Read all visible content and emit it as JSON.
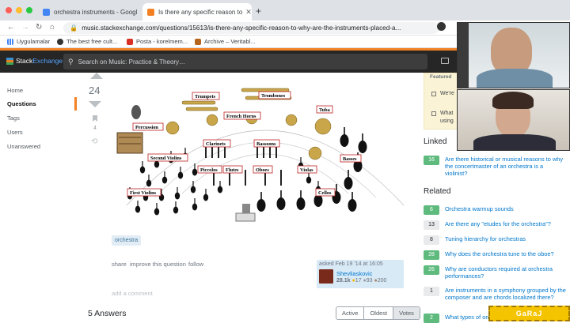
{
  "browser": {
    "tabs": [
      {
        "title": "orchestra instruments - Googl",
        "favicon_color": "#4285f4"
      },
      {
        "title": "Is there any specific reason to",
        "favicon_color": "#f48024"
      }
    ],
    "new_tab": "+",
    "url": "music.stackexchange.com/questions/15613/is-there-any-specific-reason-to-why-are-the-instruments-placed-a...",
    "bookmarks": [
      "Uygulamalar",
      "The best free cult...",
      "Posta - korelmem...",
      "Archive – Veritabl..."
    ]
  },
  "site": {
    "logo_a": "Stack",
    "logo_b": "Exchange",
    "search_placeholder": "Search on Music: Practice & Theory…"
  },
  "leftnav": [
    "Home",
    "Questions",
    "Tags",
    "Users",
    "Unanswered"
  ],
  "question": {
    "score": "24",
    "bookmarks": "4",
    "tag": "orchestra",
    "actions": [
      "share",
      "improve this question",
      "follow"
    ],
    "asked": "asked Feb 19 '14 at 16:05",
    "user": "Shevliaskovic",
    "rep": "28.1k",
    "gold": "17",
    "silver": "93",
    "bronze": "200",
    "add_comment": "add a comment"
  },
  "orchestra_labels": [
    "Trumpets",
    "Trombones",
    "Tuba",
    "Percussion",
    "French Horns",
    "Clarinets",
    "Bassoons",
    "Second Violins",
    "Piccolos",
    "Flutes",
    "Oboes",
    "Violas",
    "Basses",
    "First Violins",
    "Cellos"
  ],
  "answers": {
    "title": "5 Answers",
    "sorts": [
      "Active",
      "Oldest",
      "Votes"
    ]
  },
  "sidebar": {
    "featured": {
      "heading": "Featured",
      "items": [
        "We're",
        "What",
        "using"
      ]
    },
    "linked_heading": "Linked",
    "linked": [
      {
        "count": "16",
        "title": "Are there historical or musical reasons to why the concertmaster of an orchestra is a violinist?",
        "answered": true
      }
    ],
    "related_heading": "Related",
    "related": [
      {
        "count": "6",
        "title": "Orchestra warmup sounds",
        "answered": true
      },
      {
        "count": "13",
        "title": "Are there any \"etudes for the orchestra\"?",
        "answered": false
      },
      {
        "count": "8",
        "title": "Tuning hierarchy for orchestras",
        "answered": false
      },
      {
        "count": "28",
        "title": "Why does the orchestra tune to the oboe?",
        "answered": true
      },
      {
        "count": "26",
        "title": "Why are conductors required at orchestra performances?",
        "answered": true
      },
      {
        "count": "1",
        "title": "Are instruments in a symphony grouped by the composer and are chords localized there?",
        "answered": false
      },
      {
        "count": "2",
        "title": "What types of orc",
        "answered": true
      }
    ]
  },
  "overlay": {
    "watermark": "GaRaJ"
  }
}
